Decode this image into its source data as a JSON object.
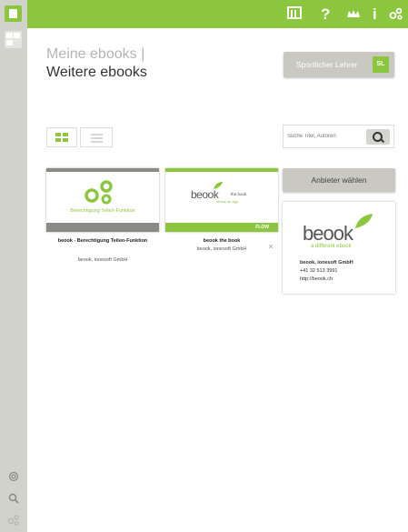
{
  "colors": {
    "accent": "#8cc63f",
    "sidebar": "#d2d2cc",
    "button_gray": "#c9c9c2",
    "card_bar_gray": "#8a8a86"
  },
  "toolbar": {
    "icons": [
      "library-icon",
      "help-icon",
      "crown-icon",
      "info-icon",
      "share-icon"
    ],
    "help_label": "?",
    "info_label": "i"
  },
  "header": {
    "my_ebooks": "Meine ebooks |",
    "more_ebooks": "Weitere ebooks"
  },
  "user_button": {
    "label": "Sportlicher Lehrer",
    "badge": "SL"
  },
  "search": {
    "placeholder": "Suche Titel, Autoren"
  },
  "books": [
    {
      "thumb_text": "Berechtigung Teilen-Funktion",
      "title": "beook - Berechtigung Teilen-Funktion",
      "publisher": "beook, ionesoft GmbH"
    },
    {
      "thumb_logo": "beook",
      "thumb_tagline1": "the book",
      "thumb_tagline2": "ebook   an app",
      "thumb_flag": "FLOW",
      "title": "beook the book",
      "publisher": "beook, ionesoft GmbH"
    }
  ],
  "provider": {
    "button_label": "Anbieter wählen",
    "logo": "beook",
    "tagline": "a different ebook",
    "name": "beook, ionesoft GmbH",
    "phone": "+41 32 513 3991",
    "url": "http://beook.ch"
  }
}
